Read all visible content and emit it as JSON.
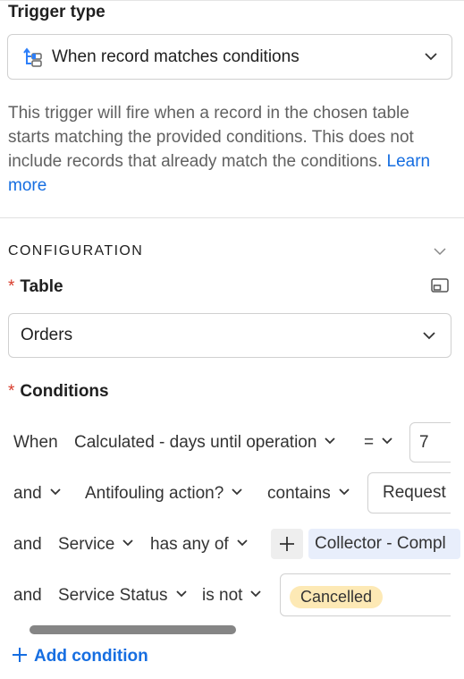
{
  "trigger": {
    "heading": "Trigger type",
    "selected": "When record matches conditions",
    "icon": "record-conditions-icon",
    "description": "This trigger will fire when a record in the chosen table starts matching the provided conditions. This does not include records that already match the conditions.",
    "learn_more": "Learn more"
  },
  "configuration": {
    "heading": "CONFIGURATION",
    "table_label": "Table",
    "required_mark": "*",
    "table_value": "Orders",
    "conditions_label": "Conditions",
    "add_condition": "Add condition"
  },
  "conditions": [
    {
      "conjunction": "When",
      "field": "Calculated - days until operation",
      "operator": "=",
      "value": "7"
    },
    {
      "conjunction": "and",
      "field": "Antifouling action?",
      "operator": "contains",
      "value": "Request"
    },
    {
      "conjunction": "and",
      "field": "Service",
      "operator": "has any of",
      "value": "Collector - Compl"
    },
    {
      "conjunction": "and",
      "field": "Service Status",
      "operator": "is not",
      "value": "Cancelled"
    }
  ],
  "colors": {
    "accent": "#166ee1",
    "required": "#d83b2b",
    "chip_blue": "#e8eefb",
    "chip_yellow": "#fde9b5"
  }
}
